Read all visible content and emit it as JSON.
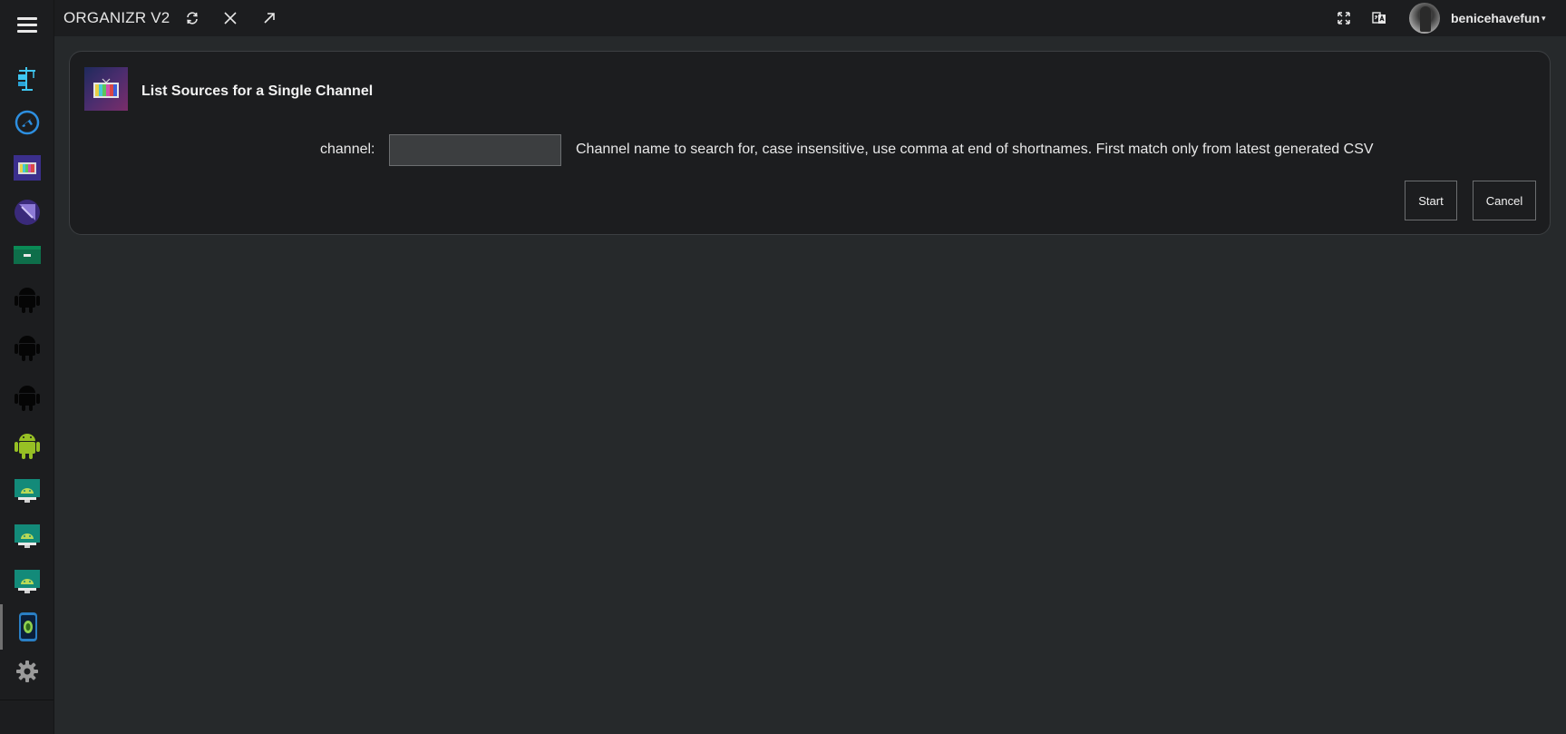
{
  "app": {
    "title": "ORGANIZR V2"
  },
  "topbar": {
    "actions": [
      "refresh-icon",
      "close-icon",
      "popout-icon"
    ],
    "right_icons": [
      "fullscreen-icon",
      "translate-icon"
    ],
    "user": {
      "name": "benicehavefun",
      "caret": "▾"
    }
  },
  "sidebar": {
    "items": [
      {
        "name": "sidebar-item-tab-1",
        "icon": "crane-icon"
      },
      {
        "name": "sidebar-item-tab-2",
        "icon": "plane-circle-icon"
      },
      {
        "name": "sidebar-item-tab-3",
        "icon": "tv-icon"
      },
      {
        "name": "sidebar-item-tab-4",
        "icon": "purple-orb-icon"
      },
      {
        "name": "sidebar-item-tab-5",
        "icon": "green-card-icon"
      },
      {
        "name": "sidebar-item-tab-6",
        "icon": "android-icon"
      },
      {
        "name": "sidebar-item-tab-7",
        "icon": "android-icon"
      },
      {
        "name": "sidebar-item-tab-8",
        "icon": "android-icon"
      },
      {
        "name": "sidebar-item-tab-9",
        "icon": "android-icon"
      },
      {
        "name": "sidebar-item-tab-10",
        "icon": "android-tv-icon"
      },
      {
        "name": "sidebar-item-tab-11",
        "icon": "android-tv-icon"
      },
      {
        "name": "sidebar-item-tab-12",
        "icon": "android-tv-icon"
      },
      {
        "name": "sidebar-item-tab-13",
        "icon": "phone-app-icon",
        "active": true
      },
      {
        "name": "sidebar-item-settings",
        "icon": "gear-icon"
      }
    ]
  },
  "panel": {
    "title": "List Sources for a Single Channel",
    "icon": "tv-icon",
    "field": {
      "label": "channel:",
      "value": "",
      "placeholder": "",
      "help": "Channel name to search for, case insensitive, use comma at end of shortnames. First match only from latest generated CSV"
    },
    "buttons": {
      "start": "Start",
      "cancel": "Cancel"
    }
  },
  "colors": {
    "background": "#26292b",
    "bar": "#1c1d1f",
    "border": "#3c3f42"
  }
}
